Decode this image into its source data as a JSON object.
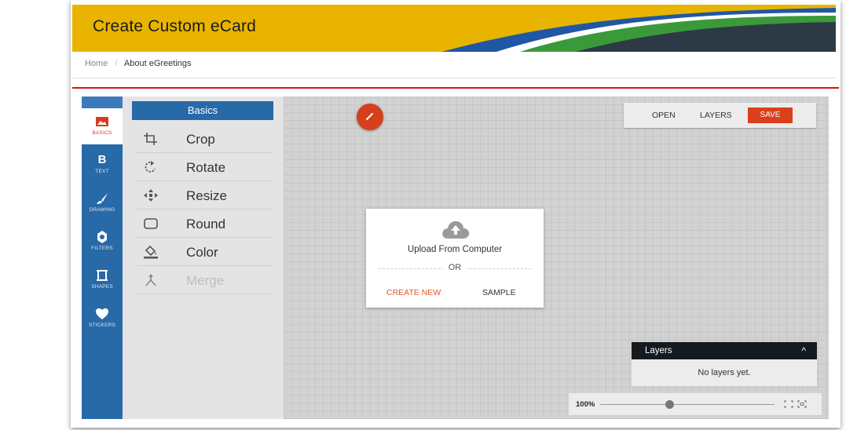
{
  "banner": {
    "title": "Create Custom eCard"
  },
  "breadcrumb": {
    "home": "Home",
    "separator": "/",
    "current": "About eGreetings"
  },
  "sidebar": {
    "items": [
      {
        "label": "BASICS",
        "icon": "image-icon",
        "active": true
      },
      {
        "label": "TEXT",
        "icon": "bold-b-icon",
        "glyph": "B"
      },
      {
        "label": "DRAWING",
        "icon": "brush-icon"
      },
      {
        "label": "FILTERS",
        "icon": "filters-icon"
      },
      {
        "label": "SHAPES",
        "icon": "shapes-icon"
      },
      {
        "label": "STICKERS",
        "icon": "heart-icon"
      }
    ]
  },
  "basics": {
    "header": "Basics",
    "tools": [
      {
        "label": "Crop",
        "icon": "crop-icon"
      },
      {
        "label": "Rotate",
        "icon": "rotate-icon"
      },
      {
        "label": "Resize",
        "icon": "resize-icon"
      },
      {
        "label": "Round",
        "icon": "rounded-rect-icon"
      },
      {
        "label": "Color",
        "icon": "paint-bucket-icon"
      },
      {
        "label": "Merge",
        "icon": "merge-icon",
        "disabled": true
      }
    ]
  },
  "actions": {
    "open": "OPEN",
    "layers": "LAYERS",
    "save": "SAVE"
  },
  "upload": {
    "text": "Upload From Computer",
    "or": "OR",
    "create_new": "CREATE NEW",
    "sample": "SAMPLE"
  },
  "layers": {
    "title": "Layers",
    "caret": "^",
    "empty": "No layers yet."
  },
  "zoom": {
    "level": "100%",
    "slider_fraction": 0.4
  },
  "colors": {
    "accent": "#d9401b",
    "sidebar_blue": "#2869a8",
    "banner_yellow": "#e8b400",
    "banner_green": "#3a9a3a",
    "banner_blue": "#1f57a5",
    "banner_dark": "#2d3a45"
  }
}
